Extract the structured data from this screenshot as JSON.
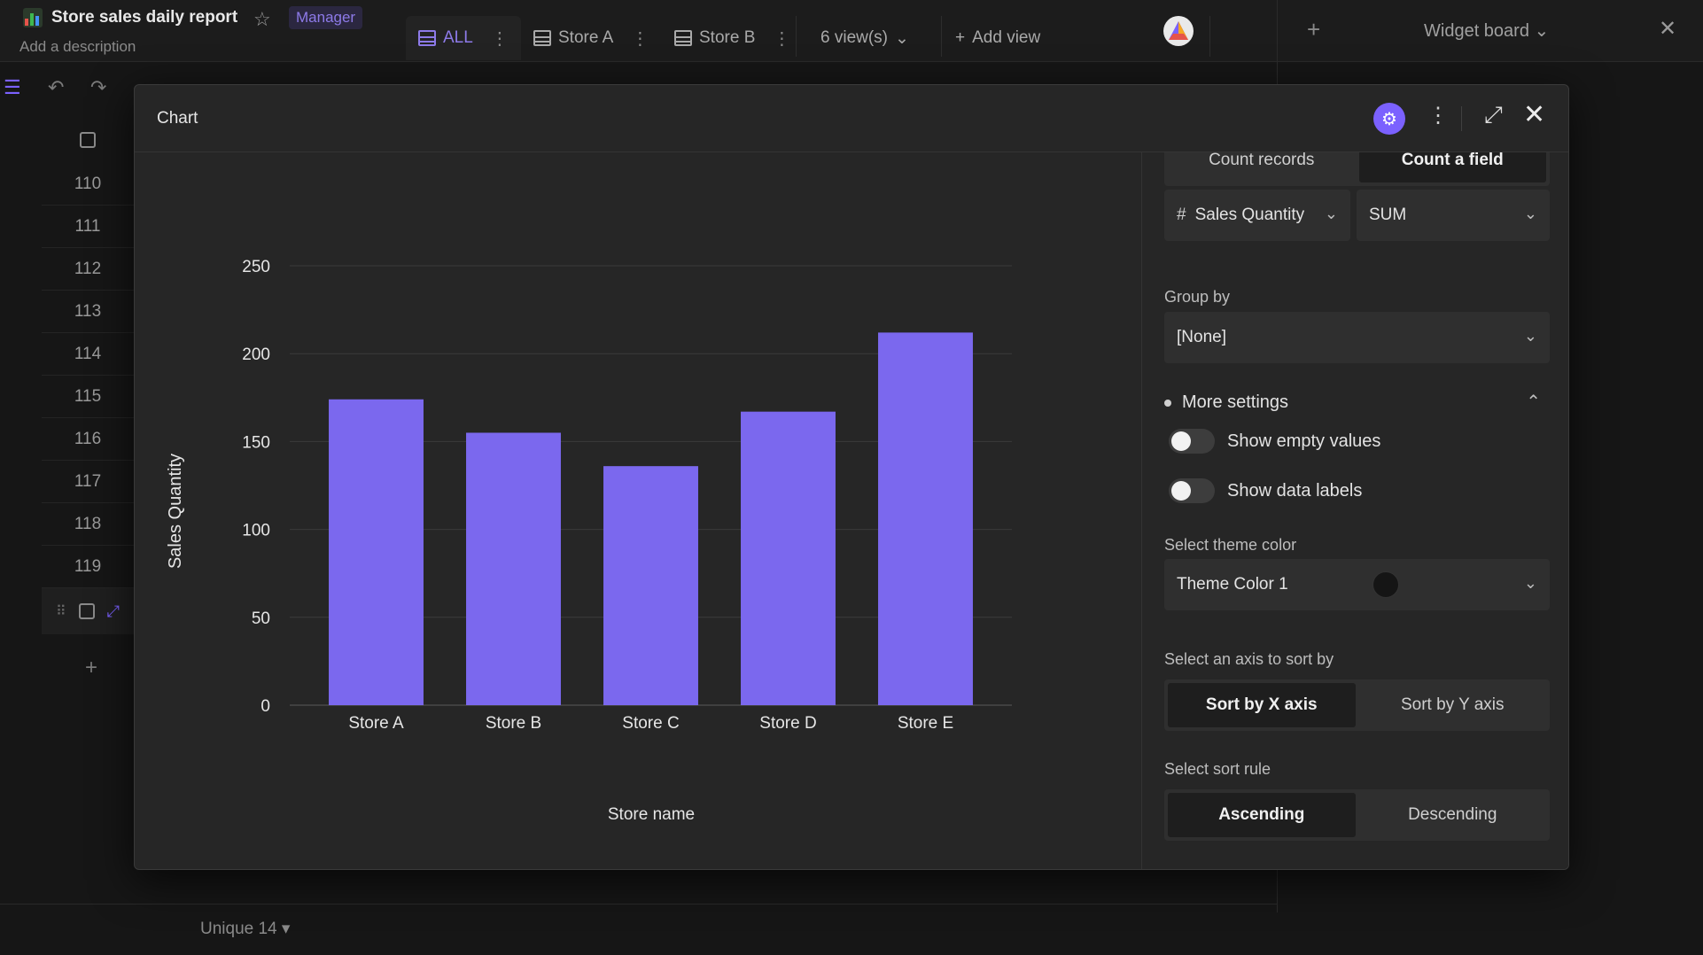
{
  "header": {
    "title": "Store sales daily report",
    "role_badge": "Manager",
    "description": "Add a description",
    "tabs": [
      {
        "label": "ALL"
      },
      {
        "label": "Store A"
      },
      {
        "label": "Store B"
      }
    ],
    "views_count": "6 view(s)",
    "add_view": "Add view"
  },
  "widget_board": {
    "title": "Widget board"
  },
  "grid": {
    "row_numbers": [
      "110",
      "111",
      "112",
      "113",
      "114",
      "115",
      "116",
      "117",
      "118",
      "119"
    ],
    "footer_unique": "Unique 14 ▾"
  },
  "modal": {
    "title": "Chart"
  },
  "panel": {
    "count_records": "Count records",
    "count_field": "Count a field",
    "field": "Sales Quantity",
    "aggregation": "SUM",
    "group_by_label": "Group by",
    "group_by_value": "[None]",
    "more_settings": "More settings",
    "show_empty_values": "Show empty values",
    "show_data_labels": "Show data labels",
    "theme_label": "Select theme color",
    "theme_value": "Theme Color 1",
    "sort_axis_label": "Select an axis to sort by",
    "sort_x": "Sort by X axis",
    "sort_y": "Sort by Y axis",
    "sort_rule_label": "Select sort rule",
    "ascending": "Ascending",
    "descending": "Descending"
  },
  "colors": {
    "accent": "#7b61ff",
    "bar": "#7b68ee",
    "background": "#262626"
  },
  "chart_data": {
    "type": "bar",
    "categories": [
      "Store A",
      "Store B",
      "Store C",
      "Store D",
      "Store E"
    ],
    "values": [
      174,
      155,
      136,
      167,
      212
    ],
    "xlabel": "Store name",
    "ylabel": "Sales Quantity",
    "ylim": [
      0,
      250
    ],
    "yticks": [
      0,
      50,
      100,
      150,
      200,
      250
    ],
    "grid": true
  }
}
